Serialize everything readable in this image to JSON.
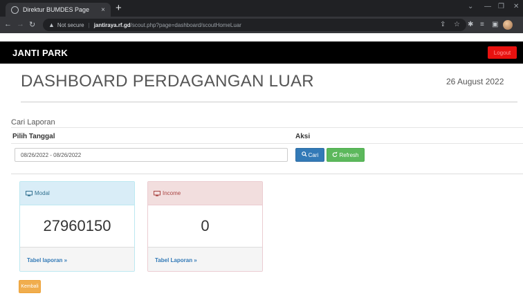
{
  "browser": {
    "tab_title": "Direktur BUMDES Page",
    "tab_close": "×",
    "new_tab": "+",
    "not_secure": "Not secure",
    "url_host": "jantiraya.rf.gd",
    "url_path": "/scout.php?page=dashboard/scoutHomeLuar"
  },
  "navbar": {
    "brand": "JANTI PARK",
    "logout_label": "Logout"
  },
  "header": {
    "title": "DASHBOARD PERDAGANGAN LUAR",
    "date": "26 August 2022"
  },
  "search": {
    "heading": "Cari Laporan",
    "col_date": "Pilih Tanggal",
    "col_action": "Aksi",
    "date_range": "08/26/2022 - 08/26/2022",
    "search_label": "Cari",
    "refresh_label": "Refresh"
  },
  "panels": [
    {
      "title": "Modal",
      "value": "27960150",
      "link": "Tabel laporan »",
      "accent": "#d9edf7"
    },
    {
      "title": "Income",
      "value": "0",
      "link": "Tabel Laporan »",
      "accent": "#f2dede"
    }
  ],
  "footer": {
    "back_label": "Kembali"
  },
  "icons": {
    "search": "search-icon",
    "refresh": "refresh-icon",
    "monitor": "monitor-icon"
  }
}
